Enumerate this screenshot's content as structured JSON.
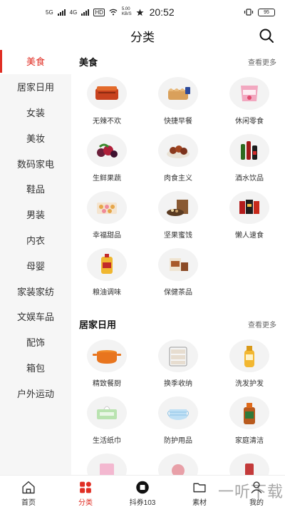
{
  "status_bar": {
    "network_1": "5G",
    "network_2": "4G",
    "hd_badge": "HD",
    "speed": "5.00",
    "speed_unit": "KB/S",
    "time": "20:52",
    "battery": "95"
  },
  "header": {
    "title": "分类"
  },
  "sidebar": {
    "items": [
      {
        "label": "美食"
      },
      {
        "label": "居家日用"
      },
      {
        "label": "女装"
      },
      {
        "label": "美妆"
      },
      {
        "label": "数码家电"
      },
      {
        "label": "鞋品"
      },
      {
        "label": "男装"
      },
      {
        "label": "内衣"
      },
      {
        "label": "母婴"
      },
      {
        "label": "家装家纺"
      },
      {
        "label": "文娱车品"
      },
      {
        "label": "配饰"
      },
      {
        "label": "箱包"
      },
      {
        "label": "户外运动"
      }
    ]
  },
  "sections": [
    {
      "title": "美食",
      "more": "查看更多",
      "items": [
        {
          "label": "无辣不欢",
          "icon": "spicy-food-icon"
        },
        {
          "label": "快捷早餐",
          "icon": "bread-icon"
        },
        {
          "label": "休闲零食",
          "icon": "snack-bag-icon"
        },
        {
          "label": "生鲜果蔬",
          "icon": "fruit-icon"
        },
        {
          "label": "肉食主义",
          "icon": "meat-icon"
        },
        {
          "label": "酒水饮品",
          "icon": "drinks-icon"
        },
        {
          "label": "幸福甜品",
          "icon": "dessert-icon"
        },
        {
          "label": "坚果蜜饯",
          "icon": "nuts-icon"
        },
        {
          "label": "懒人速食",
          "icon": "instant-noodle-icon"
        },
        {
          "label": "粮油调味",
          "icon": "oil-bottle-icon"
        },
        {
          "label": "保健茶品",
          "icon": "tea-icon"
        }
      ]
    },
    {
      "title": "居家日用",
      "more": "查看更多",
      "items": [
        {
          "label": "精致餐厨",
          "icon": "cooking-pot-icon"
        },
        {
          "label": "换季收纳",
          "icon": "storage-drawer-icon"
        },
        {
          "label": "洗发护发",
          "icon": "shampoo-icon"
        },
        {
          "label": "生活纸巾",
          "icon": "tissue-icon"
        },
        {
          "label": "防护用品",
          "icon": "face-mask-icon"
        },
        {
          "label": "家庭清洁",
          "icon": "disinfectant-icon"
        },
        {
          "label": "",
          "icon": "product-icon"
        },
        {
          "label": "",
          "icon": "product-icon"
        },
        {
          "label": "",
          "icon": "product-icon"
        }
      ]
    }
  ],
  "tabbar": {
    "tabs": [
      {
        "label": "首页",
        "icon": "home-icon"
      },
      {
        "label": "分类",
        "icon": "category-icon"
      },
      {
        "label": "抖券103",
        "icon": "coupon-icon"
      },
      {
        "label": "素材",
        "icon": "folder-icon"
      },
      {
        "label": "我的",
        "icon": "user-icon"
      }
    ]
  },
  "watermark": "一听下载",
  "colors": {
    "accent": "#e02e24",
    "sidebar_bg": "#f6f6f6",
    "text": "#333333"
  }
}
